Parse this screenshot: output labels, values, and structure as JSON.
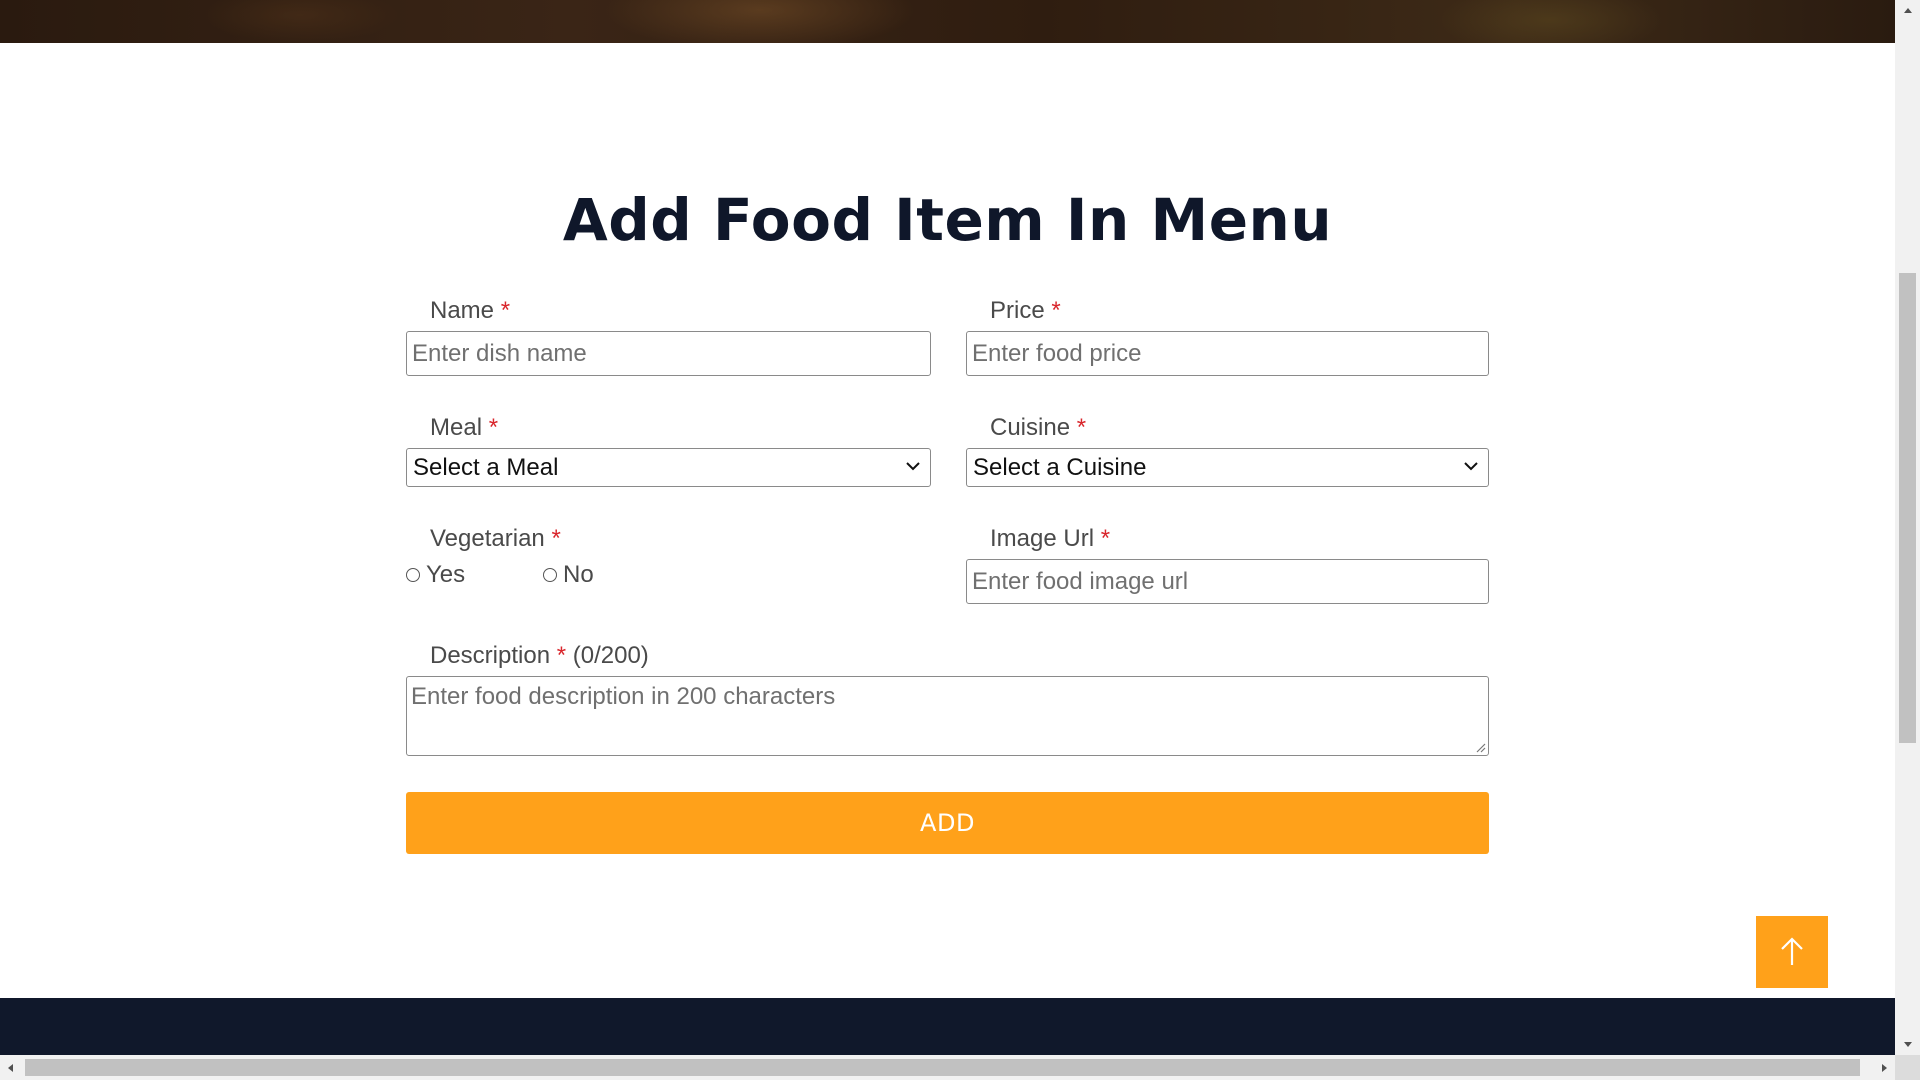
{
  "page": {
    "title": "Add Food Item In Menu"
  },
  "form": {
    "required_mark": "*",
    "name": {
      "label": "Name",
      "placeholder": "Enter dish name"
    },
    "price": {
      "label": "Price",
      "placeholder": "Enter food price"
    },
    "meal": {
      "label": "Meal",
      "selected": "Select a Meal"
    },
    "cuisine": {
      "label": "Cuisine",
      "selected": "Select a Cuisine"
    },
    "vegetarian": {
      "label": "Vegetarian",
      "options": [
        "Yes",
        "No"
      ]
    },
    "image_url": {
      "label": "Image Url",
      "placeholder": "Enter food image url"
    },
    "description": {
      "label": "Description",
      "counter": "(0/200)",
      "placeholder": "Enter food description in 200 characters"
    },
    "submit_label": "ADD"
  },
  "icons": {
    "back_to_top": "arrow-up-icon",
    "select_chevron": "chevron-down-icon"
  },
  "colors": {
    "accent": "#ffa11a",
    "title": "#0f172a",
    "required": "#d9262c",
    "footer": "#10182b"
  }
}
